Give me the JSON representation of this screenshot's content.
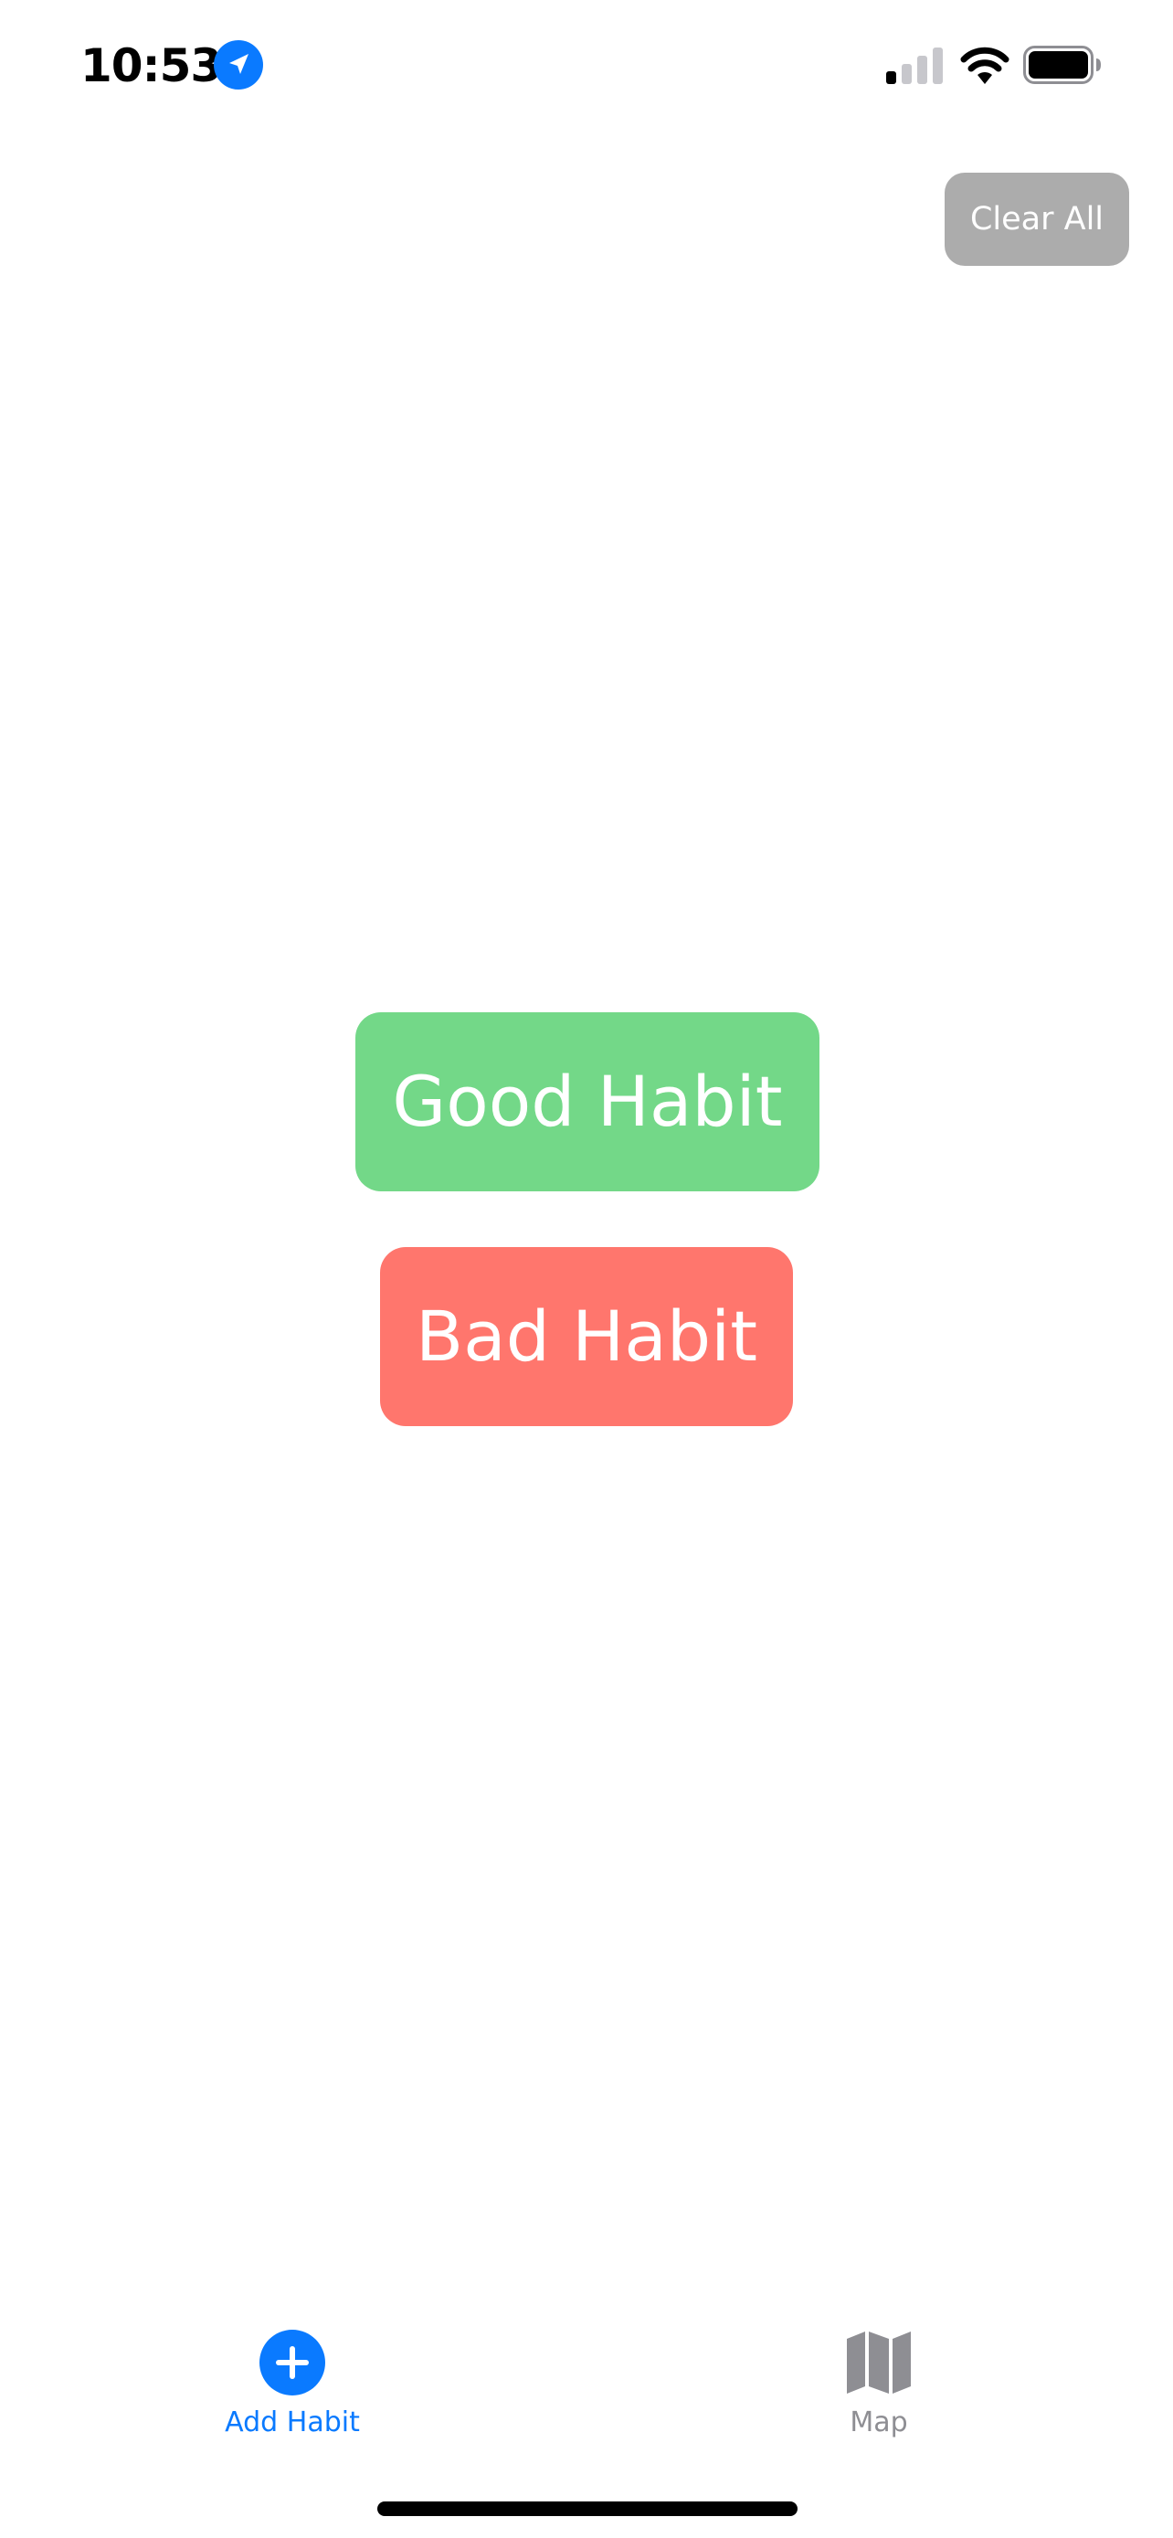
{
  "status_bar": {
    "time": "10:53",
    "location_icon": "location-arrow-icon",
    "signal_icon": "cellular-signal-icon",
    "wifi_icon": "wifi-icon",
    "battery_icon": "battery-icon"
  },
  "header": {
    "clear_all_label": "Clear All"
  },
  "main": {
    "good_habit_label": "Good Habit",
    "bad_habit_label": "Bad Habit"
  },
  "tab_bar": {
    "items": [
      {
        "label": "Add Habit",
        "icon": "plus-circle-icon",
        "selected": true
      },
      {
        "label": "Map",
        "icon": "map-icon",
        "selected": false
      }
    ]
  },
  "colors": {
    "accent": "#0a7aff",
    "good": "#73d888",
    "bad": "#ff766d",
    "clear_all": "#acacac",
    "inactive_tab": "#8e8e93"
  }
}
